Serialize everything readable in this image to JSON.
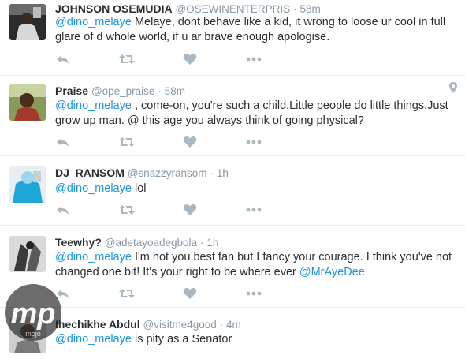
{
  "colors": {
    "mention": "#1b95e0",
    "meta": "#8899a6",
    "icon": "#aab8c2",
    "divider": "#e6ecf0"
  },
  "tweets": [
    {
      "name": "JOHNSON OSEMUDIA",
      "handle": "@OSEWINENTERPRIS",
      "dot": "·",
      "time": "58m",
      "mention": "@dino_melaye",
      "text": " Melaye, dont behave like a kid, it wrong to loose ur cool in full glare of d whole world, if u ar brave enough apologise."
    },
    {
      "name": "Praise",
      "handle": "@ope_praise",
      "dot": "·",
      "time": "58m",
      "mention": "@dino_melaye",
      "text": " , come-on, you're such a child.Little people do little things.Just grow up man. @ this age you always think of going physical?"
    },
    {
      "name": "DJ_RANSOM",
      "handle": "@snazzyransom",
      "dot": "·",
      "time": "1h",
      "mention": "@dino_melaye",
      "text": " lol"
    },
    {
      "name": "Teewhy?",
      "handle": "@adetayoadegbola",
      "dot": "·",
      "time": "1h",
      "mention": "@dino_melaye",
      "text": " I'm not you best fan but I fancy your courage. I think you've not changed one bit! It's your right to be where ever  ",
      "mention2": "@MrAyeDee"
    },
    {
      "name": "Ihechikhe Abdul",
      "handle": "@visitme4good",
      "dot": "·",
      "time": "4m",
      "mention": "@dino_melaye",
      "text": " is pity as a Senator"
    }
  ],
  "watermark": {
    "logo": "mp",
    "caption": "mojo"
  }
}
